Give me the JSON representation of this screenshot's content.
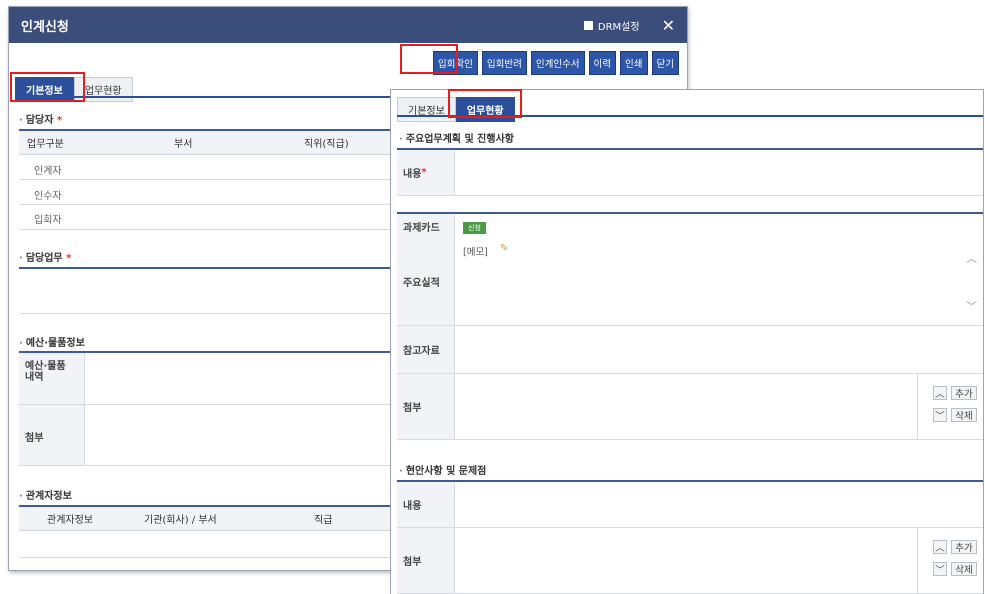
{
  "window": {
    "title": "인계신청",
    "drm_label": "DRM설정",
    "close_glyph": "✕"
  },
  "toolbar": [
    "입회확인",
    "입회반려",
    "인계인수서",
    "이력",
    "인쇄",
    "닫기"
  ],
  "tabs": [
    "기본정보",
    "업무현황"
  ],
  "basic": {
    "person_section": "담당자 ",
    "person_headers": [
      "업무구분",
      "부서",
      "직위(직급)"
    ],
    "person_rows": [
      "인계자",
      "인수자",
      "입회자"
    ],
    "task_section": "담당업무 ",
    "budget_section": "예산·물품정보",
    "budget_label": "예산·물품\n내역",
    "attach_label": "첨부",
    "related_section": "관계자정보",
    "related_headers": [
      "관계자정보",
      "기관(회사) / 부서",
      "직급"
    ]
  },
  "panel": {
    "tabs": [
      "기본정보",
      "업무현황"
    ],
    "plan_section": "주요업무계획 및 진행사항",
    "content_label": "내용 ",
    "card_label": "과제카드",
    "card_badge": "신청",
    "main_label": "주요실적",
    "memo_text": "[메모]",
    "ref_label": "참고자료",
    "attach_label": "첨부",
    "add_label": "추가",
    "del_label": "삭제",
    "issue_section": "현안사항 및 문제점",
    "issue_content_label": "내용",
    "issue_attach_label": "첨부"
  },
  "required_mark": "*"
}
